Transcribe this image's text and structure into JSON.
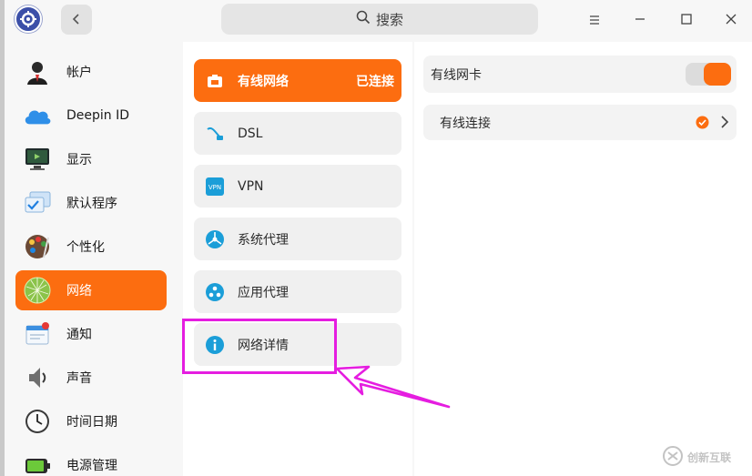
{
  "titlebar": {
    "search_label": "搜索"
  },
  "leftnav": {
    "items": [
      {
        "label": "帐户",
        "icon": "account-avatar-icon"
      },
      {
        "label": "Deepin ID",
        "icon": "cloud-icon"
      },
      {
        "label": "显示",
        "icon": "monitor-icon"
      },
      {
        "label": "默认程序",
        "icon": "default-apps-icon"
      },
      {
        "label": "个性化",
        "icon": "palette-icon"
      },
      {
        "label": "网络",
        "icon": "network-globe-icon",
        "active": true
      },
      {
        "label": "通知",
        "icon": "notification-icon"
      },
      {
        "label": "声音",
        "icon": "speaker-icon"
      },
      {
        "label": "时间日期",
        "icon": "clock-icon"
      },
      {
        "label": "电源管理",
        "icon": "battery-icon"
      }
    ]
  },
  "midcol": {
    "items": [
      {
        "label": "有线网络",
        "status": "已连接",
        "icon": "wired-network-icon",
        "active": true
      },
      {
        "label": "DSL",
        "icon": "dsl-icon"
      },
      {
        "label": "VPN",
        "icon": "vpn-icon"
      },
      {
        "label": "系统代理",
        "icon": "system-proxy-icon"
      },
      {
        "label": "应用代理",
        "icon": "app-proxy-icon"
      },
      {
        "label": "网络详情",
        "icon": "info-icon"
      }
    ]
  },
  "rightpanel": {
    "card_label": "有线网卡",
    "card_enabled": true,
    "connection_label": "有线连接",
    "connection_connected": true
  },
  "watermark": {
    "text": "创新互联"
  },
  "colors": {
    "accent": "#fc6d10",
    "annotation": "#e51de0",
    "icon_blue": "#1b9ed8"
  }
}
